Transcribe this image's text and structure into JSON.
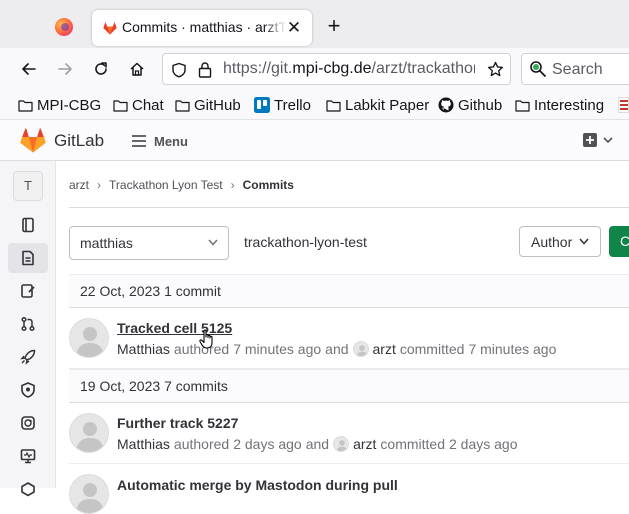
{
  "browser": {
    "tab_title": "Commits · matthias · arztTrackathon",
    "url_prefix": "https://git.",
    "url_domain": "mpi-cbg.de",
    "url_path": "/arzt/trackathon-lyon-test/-/commits",
    "search_placeholder": "Search",
    "bookmarks": [
      {
        "label": "MPI-CBG",
        "icon": "folder-icon"
      },
      {
        "label": "Chat",
        "icon": "folder-icon"
      },
      {
        "label": "GitHub",
        "icon": "folder-icon"
      },
      {
        "label": "Trello",
        "icon": "trello-icon"
      },
      {
        "label": "Labkit Paper",
        "icon": "folder-icon"
      },
      {
        "label": "Github",
        "icon": "github-icon"
      },
      {
        "label": "Interesting",
        "icon": "folder-icon"
      }
    ]
  },
  "gitlab": {
    "brand": "GitLab",
    "menu_label": "Menu",
    "project_initial": "T",
    "breadcrumb": {
      "owner": "arzt",
      "project": "Trackathon Lyon Test",
      "current": "Commits"
    },
    "branch": "matthias",
    "path": "trackathon-lyon-test",
    "author_button": "Author",
    "create_button": "Create",
    "colors": {
      "primary_green": "#108548",
      "orange": "#e24329",
      "text": "#333238",
      "muted": "#737278"
    }
  },
  "commit_groups": [
    {
      "date": "22 Oct, 2023",
      "count": "1 commit",
      "commits": [
        {
          "title": "Tracked cell 5125",
          "author": "Matthias",
          "authored": "authored",
          "authored_time": "7 minutes ago",
          "and": "and",
          "committer": "arzt",
          "committed": "committed",
          "committed_time": "7 minutes ago"
        }
      ]
    },
    {
      "date": "19 Oct, 2023",
      "count": "7 commits",
      "commits": [
        {
          "title": "Further track 5227",
          "author": "Matthias",
          "authored": "authored",
          "authored_time": "2 days ago",
          "and": "and",
          "committer": "arzt",
          "committed": "committed",
          "committed_time": "2 days ago"
        },
        {
          "title": "Automatic merge by Mastodon during pull"
        }
      ]
    }
  ]
}
